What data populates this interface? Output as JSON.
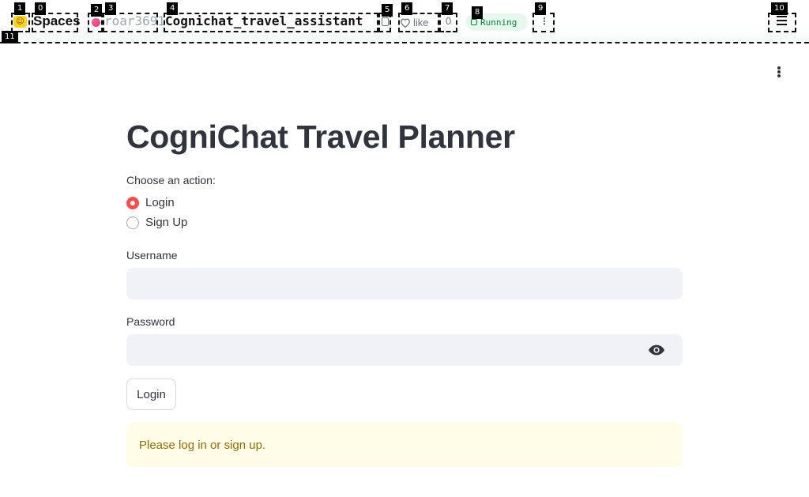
{
  "hf_header": {
    "logo_icon": "hugging-face-logo-icon",
    "spaces_label": "Spaces",
    "owner": "roar3691",
    "repo": "Cognichat_travel_assistant",
    "like_label": "like",
    "like_count": "0",
    "status": "Running",
    "status_color": "#15803d"
  },
  "annotation_tags": [
    "0",
    "1",
    "2",
    "3",
    "4",
    "5",
    "6",
    "7",
    "8",
    "9",
    "10",
    "11"
  ],
  "app": {
    "title": "CogniChat Travel Planner",
    "action_label": "Choose an action:",
    "actions": [
      {
        "label": "Login",
        "selected": true
      },
      {
        "label": "Sign Up",
        "selected": false
      }
    ],
    "username_label": "Username",
    "username_value": "",
    "password_label": "Password",
    "password_value": "",
    "login_button": "Login",
    "info_message": "Please log in or sign up.",
    "accent_color": "#ff4b4b"
  }
}
